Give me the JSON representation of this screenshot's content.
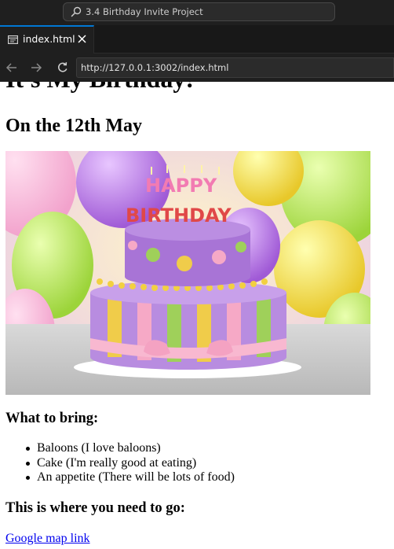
{
  "window": {
    "search_title": "3.4 Birthday Invite Project"
  },
  "tab": {
    "label": "index.html"
  },
  "navigation": {
    "url": "http://127.0.0.1:3002/index.html"
  },
  "page": {
    "heading": "It's My Birthday!",
    "date_heading": "On the 12th May",
    "cake_image": {
      "candle_text_top": "HAPPY",
      "candle_text_bottom": "BIRTHDAY"
    },
    "bring_heading": "What to bring:",
    "bring_items": [
      "Baloons (I love baloons)",
      "Cake (I'm really good at eating)",
      "An appetite (There will be lots of food)"
    ],
    "directions_heading": "This is where you need to go:",
    "map_link": "Google map link"
  },
  "colors": {
    "editor_background": "#1f1f1f",
    "tab_accent": "#0078d4",
    "link": "#0000ee"
  },
  "icons": [
    "search-icon",
    "file-html-icon",
    "close-icon",
    "arrow-left-icon",
    "arrow-right-icon",
    "reload-icon"
  ]
}
